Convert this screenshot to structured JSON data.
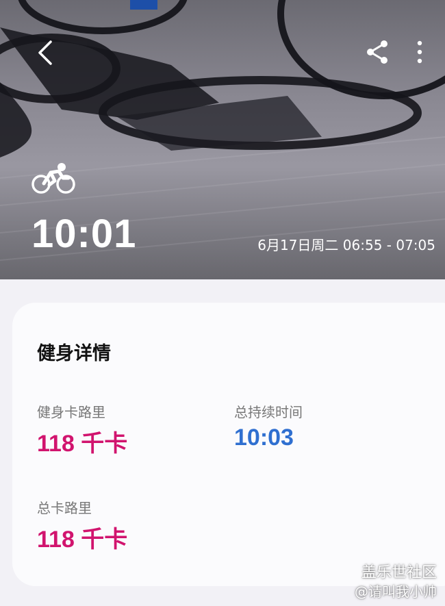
{
  "header": {
    "duration": "10:01",
    "datetime": "6月17日周二 06:55 - 07:05",
    "back_icon": "chevron-left-icon",
    "share_icon": "share-icon",
    "more_icon": "more-vertical-icon",
    "sport_icon": "cycling-icon"
  },
  "details": {
    "title": "健身详情",
    "stats": [
      {
        "label": "健身卡路里",
        "value": "118 千卡",
        "color": "#d1146e"
      },
      {
        "label": "总持续时间",
        "value": "10:03",
        "color": "#2f6fd0"
      },
      {
        "label": "总卡路里",
        "value": "118 千卡",
        "color": "#d1146e"
      }
    ]
  },
  "watermark": {
    "line1": "盖乐世社区",
    "line2": "@请叫我小帅"
  }
}
